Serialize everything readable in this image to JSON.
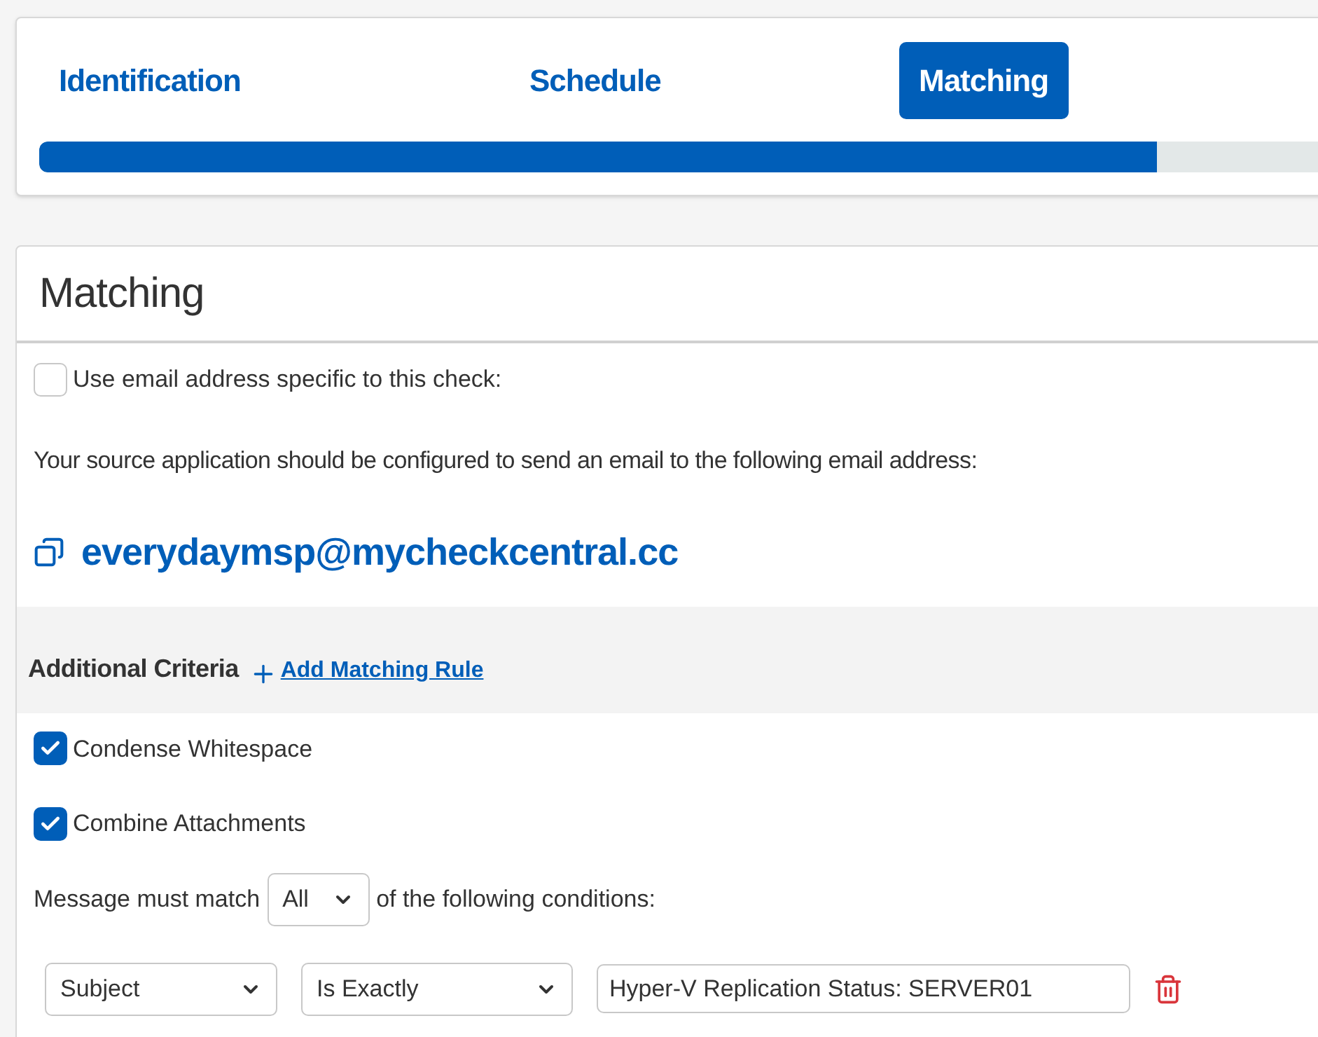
{
  "steps": [
    {
      "label": "Identification",
      "selected": false
    },
    {
      "label": "Schedule",
      "selected": false
    },
    {
      "label": "Matching",
      "selected": true
    }
  ],
  "progress": {
    "level": 0.874
  },
  "panel": {
    "title": "Matching",
    "specific_email": {
      "label": "Use email address specific to this check:",
      "checked": false
    },
    "instructions": "Your source application should be configured to send an email to the following email address:",
    "email": "everydaymsp@mycheckcentral.cc",
    "criteria": {
      "title": "Additional Criteria",
      "add_link": "Add Matching Rule"
    },
    "options": [
      {
        "label": "Condense Whitespace",
        "checked": true
      },
      {
        "label": "Combine Attachments",
        "checked": true
      }
    ],
    "match_line": {
      "before": "Message must match",
      "value": "All",
      "after": "of the following conditions:"
    },
    "conditions": [
      {
        "field": "Subject",
        "operator": "Is Exactly",
        "value": "Hyper-V Replication Status: SERVER01"
      }
    ]
  }
}
